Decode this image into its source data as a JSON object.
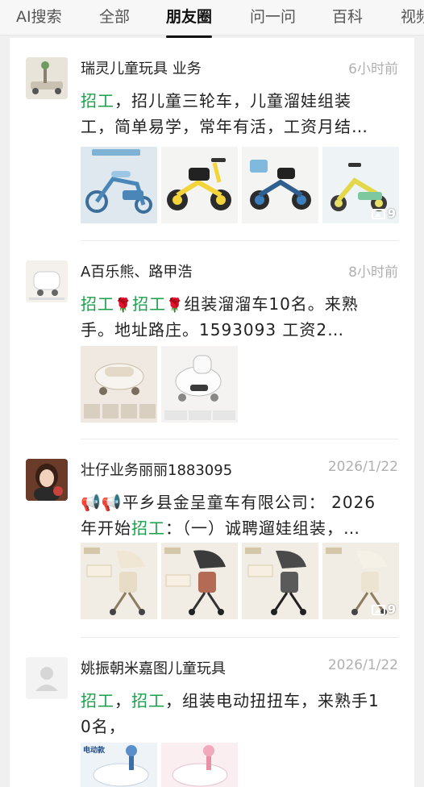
{
  "tabs": [
    {
      "label": "AI搜索",
      "active": false
    },
    {
      "label": "全部",
      "active": false
    },
    {
      "label": "朋友圈",
      "active": true
    },
    {
      "label": "问一问",
      "active": false
    },
    {
      "label": "百科",
      "active": false
    },
    {
      "label": "视频",
      "active": false
    }
  ],
  "posts": [
    {
      "name": "瑞灵儿童玩具 业务",
      "time": "6小时前",
      "text_line1_hl": "招工",
      "text_line1_rest": "，招儿童三轮车，儿童溜娃组装",
      "text_line2": "工，简单易学，常年有活，工资月结…",
      "images": [
        "blue-kids-tricycle",
        "black-yellow-tricycle",
        "blue-basket-tricycle",
        "yellow-tricycle"
      ],
      "image_count": "9"
    },
    {
      "name": "A百乐熊、路甲浩",
      "time": "8小时前",
      "text_line1_hl_a": "招工",
      "text_line1_hl_b": "招工",
      "text_line1_rest": "组装溜溜车10名。来熟",
      "rose": "🌹",
      "text_line2": "手。地址路庄。1593093     工资2…",
      "images": [
        "ride-on-toy-catalog",
        "dinosaur-ride-on-car"
      ]
    },
    {
      "name": "壮仔业务丽丽1883095",
      "time": "2026/1/22",
      "megaphone": "📢📢",
      "text_line1_rest": "平乡县金呈童车有限公司： 2026",
      "text_line2_pre": "年开始",
      "text_line2_hl": "招工",
      "text_line2_rest": "：（一）诚聘遛娃组装，…",
      "images": [
        "stroller-beige",
        "stroller-dark-gray",
        "stroller-dark",
        "stroller-olive",
        "stroller-white"
      ],
      "image_count": "9"
    },
    {
      "name": "姚振朝米嘉图儿童玩具",
      "time": "2026/1/22",
      "text_line1_hl_a": "招工",
      "text_line1_hl_b": "招工",
      "text_line1_rest": "，组装电动扭扭车，来熟手1",
      "text_line2": "0名，",
      "images": [
        "blue-swing-car",
        "pink-swing-car"
      ],
      "image_tag": "电动款"
    }
  ],
  "colors": {
    "accent_green": "#1aa04a",
    "time_gray": "#b0b0b0",
    "rose_red": "#d72a2a"
  }
}
